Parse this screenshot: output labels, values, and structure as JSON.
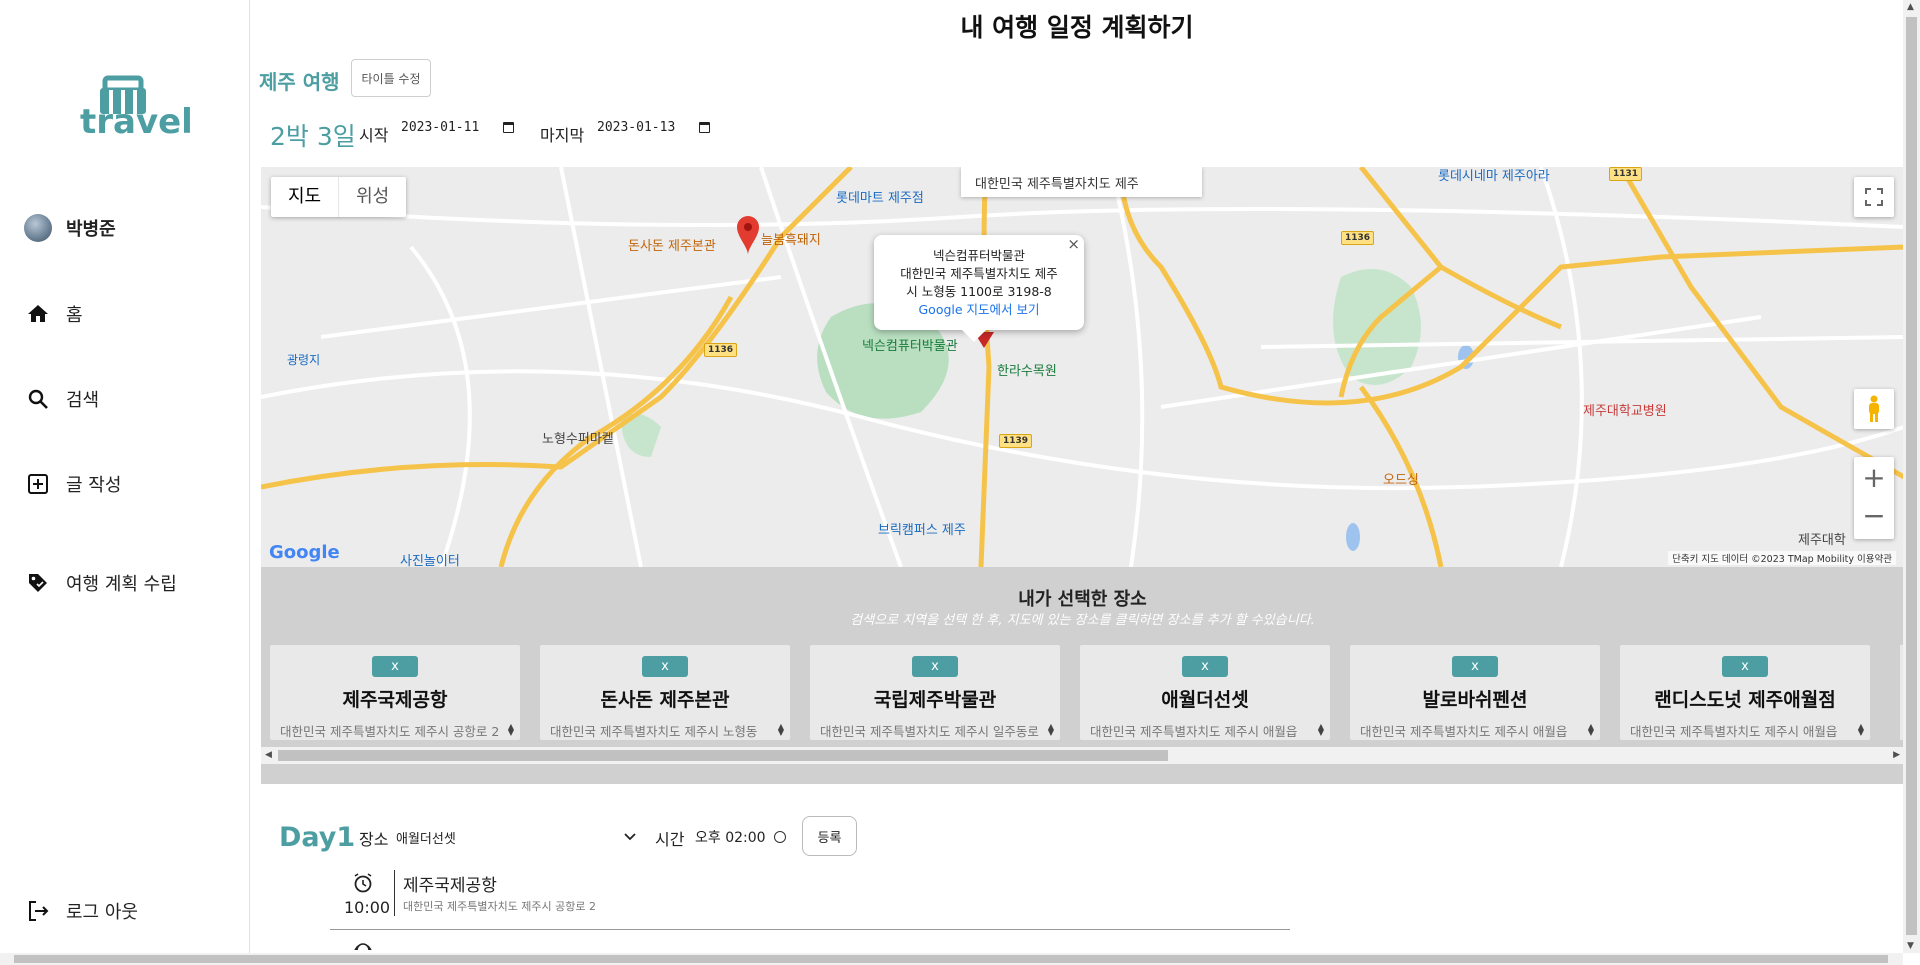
{
  "sidebar": {
    "logo_text": "travel",
    "user_name": "박병준",
    "items": [
      {
        "label": "홈",
        "icon": "home-icon"
      },
      {
        "label": "검색",
        "icon": "search-icon"
      },
      {
        "label": "글 작성",
        "icon": "add-box-icon"
      },
      {
        "label": "여행 계획 수립",
        "icon": "tag-icon"
      }
    ],
    "logout_label": "로그 아웃"
  },
  "header": {
    "page_title": "내 여행 일정 계획하기",
    "trip_title": "제주 여행",
    "title_edit_label": "타이틀 수정",
    "duration": "2박 3일",
    "start_label": "시작",
    "start_date": "2023-01-11",
    "end_label": "마지막",
    "end_date": "2023-01-13"
  },
  "map": {
    "type_map": "지도",
    "type_satellite": "위성",
    "address_box": "대한민국 제주특별자치도 제주",
    "info_window": {
      "title": "넥슨컴퓨터박물관",
      "address_line1": "대한민국 제주특별자치도 제주",
      "address_line2": "시 노형동 1100로 3198-8",
      "link": "Google 지도에서 보기"
    },
    "google_logo": "Google",
    "footer": "단축키   지도 데이터 ©2023 TMap Mobility   이용약관",
    "labels": {
      "lotte_mart": "롯데마트 제주점",
      "lotte_cinema": "롯데시네마 제주아라",
      "donsadon": "돈사돈 제주본관",
      "neulbom": "늘봄흑돼지",
      "nexon": "넥슨컴퓨터박물관",
      "halla": "한라수목원",
      "nohyeong": "노형수퍼마켙",
      "brick": "브릭캠퍼스 제주",
      "odsing": "오드싱",
      "jeju_univ_hosp": "제주대학교병원",
      "jeju_univ": "제주대학",
      "photo": "사진놀이터",
      "gwangryeong": "광령지",
      "road_1136": "1136",
      "road_1139": "1139",
      "road_1131": "1131"
    }
  },
  "picked": {
    "title": "내가 선택한 장소",
    "subtitle": "검색으로 지역을 선택 한 후, 지도에 있는 장소를 클릭하면 장소를 추가 할 수있습니다.",
    "remove_label": "x",
    "places": [
      {
        "name": "제주국제공항",
        "address": "대한민국 제주특별자치도 제주시 공항로 2"
      },
      {
        "name": "돈사돈 제주본관",
        "address": "대한민국 제주특별자치도 제주시 노형동"
      },
      {
        "name": "국립제주박물관",
        "address": "대한민국 제주특별자치도 제주시 일주동로"
      },
      {
        "name": "애월더선셋",
        "address": "대한민국 제주특별자치도 제주시 애월읍"
      },
      {
        "name": "발로바쉬펜션",
        "address": "대한민국 제주특별자치도 제주시 애월읍"
      },
      {
        "name": "랜디스도넛 제주애월점",
        "address": "대한민국 제주특별자치도 제주시 애월읍"
      }
    ]
  },
  "plan": {
    "day_label": "Day1",
    "place_label": "장소",
    "place_value": "애월더선셋",
    "time_label": "시간",
    "time_value": "오후 02:00",
    "register_label": "등록",
    "schedule": [
      {
        "time": "10:00",
        "name": "제주국제공항",
        "address": "대한민국 제주특별자치도 제주시 공항로 2"
      }
    ]
  },
  "colors": {
    "accent": "#4d9ea2",
    "panel_gray": "#d0d0d0"
  }
}
